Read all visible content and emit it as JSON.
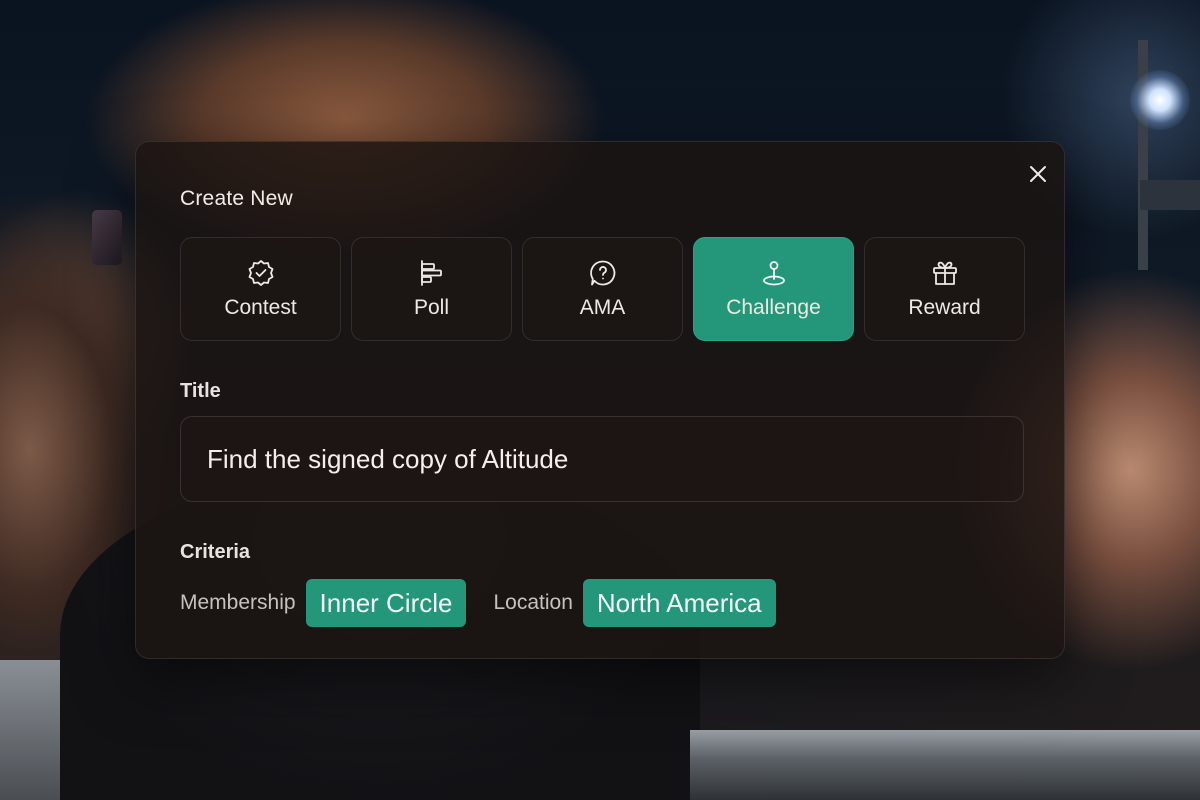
{
  "dialog": {
    "heading": "Create New",
    "close_icon": "close-icon"
  },
  "types": [
    {
      "label": "Contest",
      "icon": "badge-check-icon",
      "selected": false
    },
    {
      "label": "Poll",
      "icon": "bar-chart-horizontal-icon",
      "selected": false
    },
    {
      "label": "AMA",
      "icon": "question-bubble-icon",
      "selected": false
    },
    {
      "label": "Challenge",
      "icon": "map-pin-icon",
      "selected": true
    },
    {
      "label": "Reward",
      "icon": "gift-icon",
      "selected": false
    }
  ],
  "title_field": {
    "label": "Title",
    "value": "Find the signed copy of Altitude"
  },
  "criteria": {
    "label": "Criteria",
    "membership": {
      "key": "Membership",
      "value": "Inner Circle"
    },
    "location": {
      "key": "Location",
      "value": "North America"
    }
  },
  "colors": {
    "accent": "#24977a",
    "modal_bg": "#1c1412",
    "text": "#f1ece8"
  }
}
